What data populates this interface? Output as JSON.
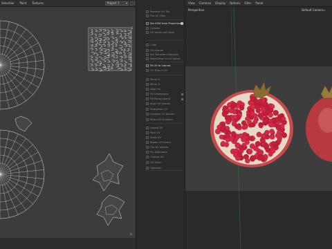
{
  "uv_menu": {
    "items": [
      "Selection",
      "Paint",
      "Textures"
    ],
    "project": "Project 1"
  },
  "tools": [
    {
      "label": "Remove UV Tile",
      "style": "dim"
    },
    {
      "label": "Flip UV Tiles",
      "style": "dim"
    },
    {
      "label": "Set UVW from Projection",
      "style": "bright",
      "info": true
    },
    {
      "label": "Cylinder",
      "style": "dim"
    },
    {
      "label": "UV Vertex set Value",
      "style": "dim"
    },
    {
      "label": "Cube",
      "style": "dim"
    },
    {
      "label": "UV Islands",
      "style": "dim"
    },
    {
      "label": "Set Transform Mapping",
      "style": "dim"
    },
    {
      "label": "Reset Mesh to UV Space",
      "style": "dim"
    },
    {
      "label": "Fit UV to Canvas",
      "style": "bright"
    },
    {
      "label": "UV Tiles in UV",
      "style": "dim"
    },
    {
      "label": "Mirror U",
      "style": "dim"
    },
    {
      "label": "Mirror V",
      "style": "dim"
    },
    {
      "label": "Align UV",
      "style": "dim"
    },
    {
      "label": "Fill Unwrapped",
      "style": "dim",
      "square": true
    },
    {
      "label": "Fill Ready Island",
      "style": "dim",
      "square": true
    },
    {
      "label": "Align UV Islands",
      "style": "dim"
    },
    {
      "label": "Straighten UV",
      "style": "dim"
    },
    {
      "label": "Equalize UV Islands",
      "style": "dim"
    },
    {
      "label": "Relax UV to Island",
      "style": "dim"
    },
    {
      "label": "Layout UV",
      "style": "dim"
    },
    {
      "label": "Pack UV",
      "style": "dim"
    },
    {
      "label": "Scale UV",
      "style": "dim"
    },
    {
      "label": "Rotate UV Island",
      "style": "dim"
    },
    {
      "label": "Flip UV Islands",
      "style": "dim"
    },
    {
      "label": "Pin Alignment",
      "style": "dim"
    },
    {
      "label": "Unwrap Sel",
      "style": "dim"
    },
    {
      "label": "UV Stitch",
      "style": "dim"
    },
    {
      "label": "Optimize",
      "style": "dim"
    }
  ],
  "viewport_menu": {
    "items": [
      "View",
      "Cameras",
      "Display",
      "Options",
      "Filter",
      "Panel"
    ]
  },
  "viewport": {
    "label": "Perspective",
    "camera": "Default Camera"
  },
  "colors": {
    "uv_background": "#3c3c3c",
    "uv_lines": "#e6e6e6",
    "pomegranate_red": "#c21f3a",
    "pomegranate_skin": "#c94a4a",
    "pith": "#e8d9c6"
  }
}
